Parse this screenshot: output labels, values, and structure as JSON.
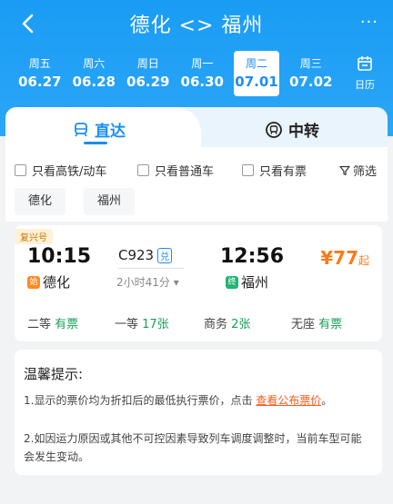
{
  "header": {
    "title": "德化 <> 福州",
    "more": "···"
  },
  "dates": [
    {
      "weekday": "周五",
      "date": "06.27",
      "active": false
    },
    {
      "weekday": "周六",
      "date": "06.28",
      "active": false
    },
    {
      "weekday": "周日",
      "date": "06.29",
      "active": false
    },
    {
      "weekday": "周一",
      "date": "06.30",
      "active": false
    },
    {
      "weekday": "周二",
      "date": "07.01",
      "active": true
    },
    {
      "weekday": "周三",
      "date": "07.02",
      "active": false
    }
  ],
  "calendar_label": "日历",
  "tabs": {
    "direct": "直达",
    "transfer": "中转"
  },
  "filters": {
    "high_speed": "只看高铁/动车",
    "normal": "只看普通车",
    "available": "只看有票",
    "filter": "筛选"
  },
  "stations": {
    "from": "德化",
    "to": "福州"
  },
  "train_card": {
    "badge": "复兴号",
    "depart_time": "10:15",
    "depart_tag": "始",
    "depart_station": "德化",
    "train_no": "C923",
    "train_tag": "兑",
    "duration": "2小时41分",
    "arrive_time": "12:56",
    "arrive_tag": "终",
    "arrive_station": "福州",
    "price": "¥77",
    "price_suffix": "起",
    "seats": [
      {
        "name": "二等",
        "value": "有票"
      },
      {
        "name": "一等",
        "value": "17张"
      },
      {
        "name": "商务",
        "value": "2张"
      },
      {
        "name": "无座",
        "value": "有票"
      }
    ]
  },
  "notice": {
    "title": "温馨提示:",
    "line1_prefix": "1.显示的票价均为折扣后的最低执行票价，点击 ",
    "line1_link": "查看公布票价",
    "line1_suffix": "。",
    "line2": "2.如因运力原因或其他不可控因素导致列车调度调整时，当前车型可能会发生变动。"
  },
  "colors": {
    "brand": "#1a9cf4",
    "accent": "#1a8ef0",
    "price": "#ff7a1a",
    "available": "#18a058"
  }
}
